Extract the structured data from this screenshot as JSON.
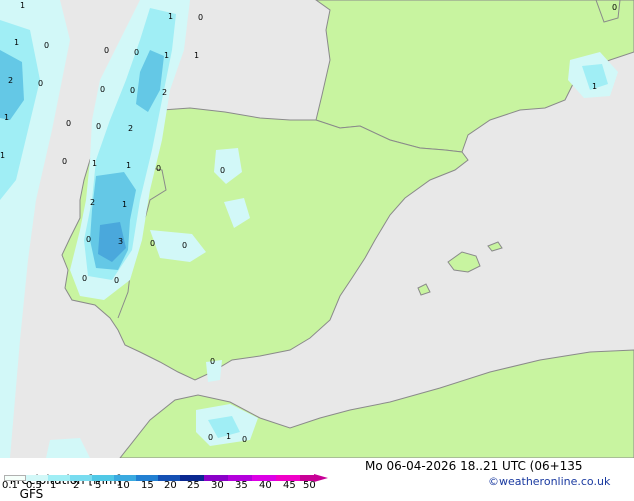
{
  "map": {
    "region": "Iberian Peninsula",
    "colors": {
      "sea": "#e8e8e8",
      "land": "#c8f4a0",
      "border": "#8a8a8a",
      "precip_light": "#d2f8f8",
      "precip_mid": "#a0eef5",
      "precip_heavy": "#64c8e6",
      "precip_strong": "#4aa8dc"
    },
    "values": [
      "1",
      "1",
      "0",
      "2",
      "0",
      "1",
      "1",
      "0",
      "0",
      "1",
      "0",
      "0",
      "0",
      "1",
      "1",
      "0",
      "0",
      "2",
      "0",
      "1",
      "2",
      "1",
      "0",
      "2",
      "1",
      "0",
      "3",
      "0",
      "0",
      "0",
      "0",
      "0",
      "0",
      "0",
      "1",
      "0",
      "0",
      "1"
    ]
  },
  "footer": {
    "title": "Precipitation [mm]",
    "model": "GFS",
    "datetime": "Mo 06-04-2026 18..21 UTC (06+135",
    "credit": "©weatheronline.co.uk"
  },
  "legend": {
    "ticks": [
      "0.1",
      "0.5",
      "1",
      "2",
      "5",
      "10",
      "15",
      "20",
      "25",
      "30",
      "35",
      "40",
      "45",
      "50"
    ],
    "colors": [
      "#f5fffa",
      "#d2f8f8",
      "#a0eef5",
      "#78dcf0",
      "#50c8e6",
      "#3aaae0",
      "#2280d2",
      "#1450b4",
      "#0a2890",
      "#8a00c8",
      "#b400dc",
      "#dc00e6",
      "#f000c8",
      "#c80096"
    ]
  }
}
